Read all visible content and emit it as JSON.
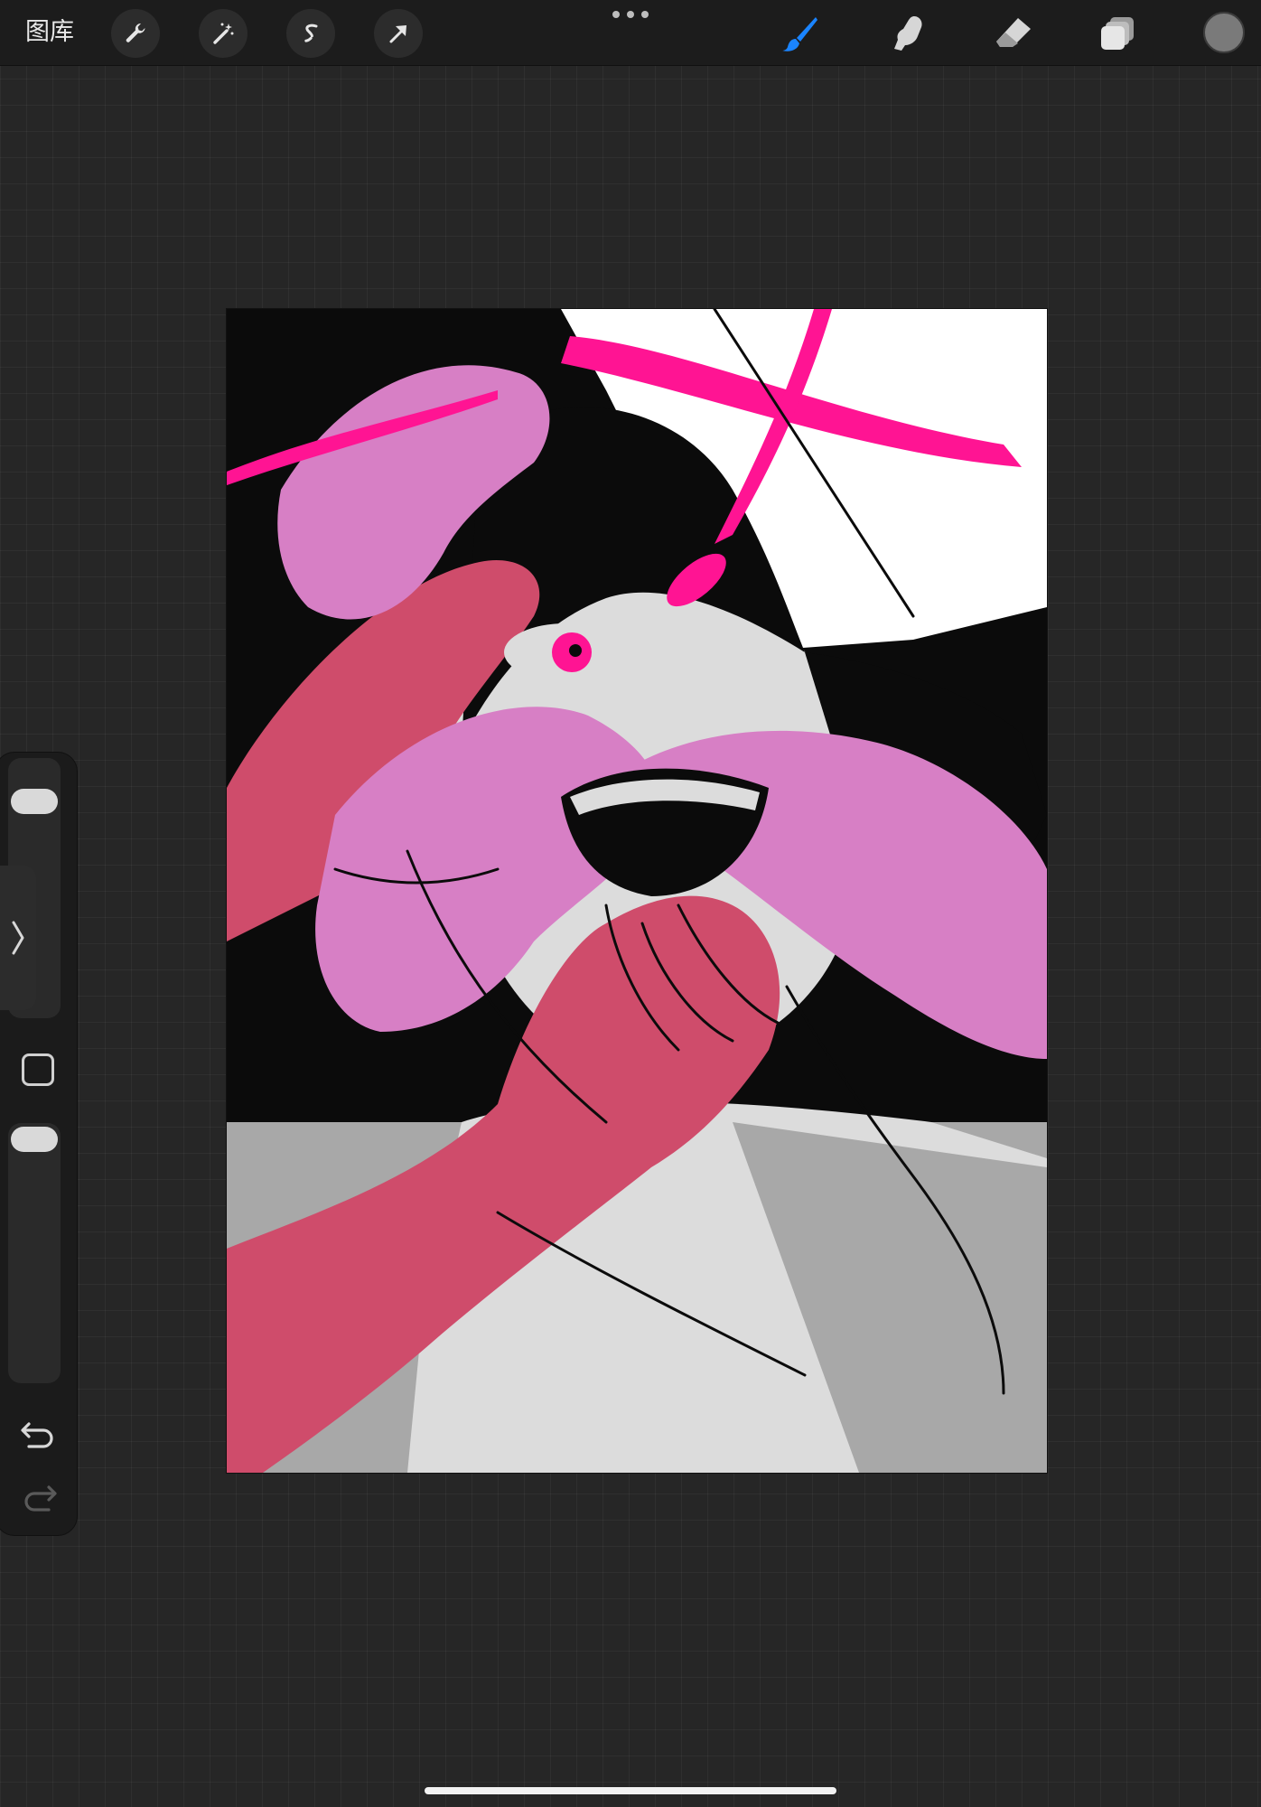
{
  "topbar": {
    "gallery_label": "图库",
    "left_tools": [
      {
        "name": "actions",
        "icon": "wrench-icon"
      },
      {
        "name": "adjustments",
        "icon": "magic-wand-icon"
      },
      {
        "name": "selection",
        "icon": "selection-s-icon"
      },
      {
        "name": "transform",
        "icon": "arrow-cursor-icon"
      }
    ],
    "right_tools": [
      {
        "name": "brush",
        "icon": "brush-icon",
        "active": true
      },
      {
        "name": "smudge",
        "icon": "smudge-finger-icon",
        "active": false
      },
      {
        "name": "eraser",
        "icon": "eraser-icon",
        "active": false
      },
      {
        "name": "layers",
        "icon": "layers-icon",
        "active": false
      }
    ],
    "current_color": "#7a7a7a",
    "active_tool_color": "#1a84ff"
  },
  "sidebar": {
    "brush_size_level": 0.88,
    "opacity_level": 1.0,
    "icons": [
      "chevron-right-icon",
      "square-modify-icon",
      "undo-icon",
      "redo-icon"
    ]
  },
  "artwork": {
    "colors": {
      "black": "#0b0b0b",
      "hot_pink": "#ff1493",
      "lilac": "#d77fc5",
      "crimson": "#cf4c6b",
      "light_gray": "#dcdcdc",
      "mid_gray": "#a8a8a8",
      "paper": "#ffffff"
    }
  }
}
